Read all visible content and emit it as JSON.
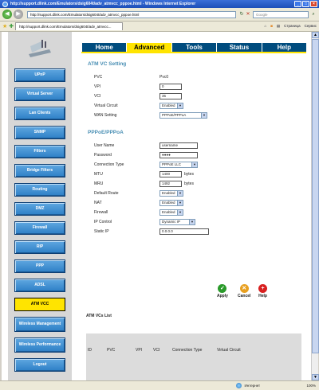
{
  "window": {
    "title": "http://support.dlink.com/Emulators/dsig604t/adv_atmvcc_pppoe.html - Windows Internet Explorer"
  },
  "addressbar": {
    "url": "http://support.dlink.com/Emulators/dsig604t/adv_atmvcc_pppoe.html",
    "search_placeholder": "Google"
  },
  "tabbar": {
    "tab_label": "http://support.dlink.com/Emulators/dsig604t/adv_atmvcc...",
    "tools": [
      "Страница",
      "Сервис"
    ]
  },
  "top_tabs": [
    "Home",
    "Advanced",
    "Tools",
    "Status",
    "Help"
  ],
  "sidebar": {
    "items": [
      {
        "label": "UPnP"
      },
      {
        "label": "Virtual Server"
      },
      {
        "label": "Lan Clients"
      },
      {
        "label": "SNMP"
      },
      {
        "label": "Filters"
      },
      {
        "label": "Bridge Filters"
      },
      {
        "label": "Routing"
      },
      {
        "label": "DMZ"
      },
      {
        "label": "Firewall"
      },
      {
        "label": "RIP"
      },
      {
        "label": "PPP"
      },
      {
        "label": "ADSL"
      },
      {
        "label": "ATM VCC"
      },
      {
        "label": "Wireless Management"
      },
      {
        "label": "Wireless Performance"
      },
      {
        "label": "Logout"
      }
    ],
    "active_index": 12
  },
  "atm_section": {
    "title": "ATM VC Setting",
    "pvc_label": "PVC",
    "pvc_value": "Pvc0",
    "vpi_label": "VPI",
    "vpi_value": "0",
    "vci_label": "VCI",
    "vci_value": "35",
    "vc_label": "Virtual Circuit",
    "vc_value": "Enabled",
    "wan_label": "WAN Setting",
    "wan_value": "PPPoE/PPPoA"
  },
  "ppp_section": {
    "title": "PPPoE/PPPoA",
    "user_label": "User Name",
    "user_value": "username",
    "pass_label": "Password",
    "pass_value": "●●●●",
    "conn_label": "Connection Type",
    "conn_value": "PPPoE LLC",
    "mtu_label": "MTU",
    "mtu_value": "1400",
    "mtu_unit": "bytes",
    "mru_label": "MRU",
    "mru_value": "1492",
    "mru_unit": "bytes",
    "route_label": "Default Route",
    "route_value": "Enabled",
    "nat_label": "NAT",
    "nat_value": "Enabled",
    "fw_label": "Firewall",
    "fw_value": "Enabled",
    "ipc_label": "IP Control",
    "ipc_value": "Dynamic IP",
    "sip_label": "Static IP",
    "sip_value": "0.0.0.0"
  },
  "actions": {
    "apply": "Apply",
    "cancel": "Cancel",
    "help": "Help"
  },
  "atm_list": {
    "title": "ATM VCs List",
    "columns": [
      "ID",
      "PVC",
      "VPI",
      "VCI",
      "Connection Type",
      "Virtual Circuit"
    ]
  },
  "statusbar": {
    "zone": "Интернет",
    "zoom": "100%"
  },
  "colors": {
    "nav_blue": "#004c7e",
    "accent_yellow": "#ffe400",
    "section_title": "#4a8fb4",
    "sidebar_button": "#2d7fc6"
  }
}
